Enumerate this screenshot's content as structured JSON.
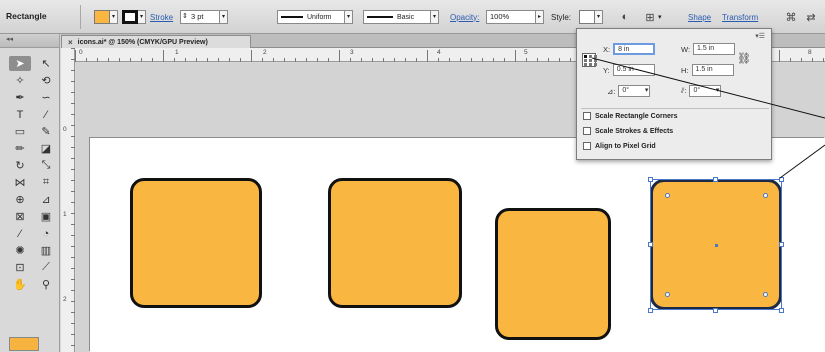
{
  "control_bar": {
    "tool_name": "Rectangle",
    "fill_color": "#f9b640",
    "stroke_color": "#111111",
    "stroke_link": "Stroke",
    "stroke_weight": "3 pt",
    "profile_label": "Uniform",
    "brush_label": "Basic",
    "opacity_link": "Opacity:",
    "opacity_value": "100%",
    "style_label": "Style:",
    "shape_link": "Shape",
    "transform_link": "Transform"
  },
  "document": {
    "tab_title": "icons.ai* @ 150% (CMYK/GPU Preview)",
    "close_glyph": "×"
  },
  "ruler": {
    "top_numbers": [
      "0",
      "1",
      "2",
      "3",
      "4",
      "5",
      "6",
      "8"
    ],
    "left_numbers": [
      "0",
      "1",
      "2"
    ]
  },
  "transform_panel": {
    "x_label": "X:",
    "x_value": "8 in",
    "w_label": "W:",
    "w_value": "1.5 in",
    "y_label": "Y:",
    "y_value": "0.5 in",
    "h_label": "H:",
    "h_value": "1.5 in",
    "rotate_value": "0°",
    "shear_value": "0°",
    "scale_corners": "Scale Rectangle Corners",
    "scale_strokes": "Scale Strokes & Effects",
    "align_pixel": "Align to Pixel Grid"
  },
  "colors": {
    "rect_fill": "#f9b640",
    "selection": "#4a78c9"
  }
}
